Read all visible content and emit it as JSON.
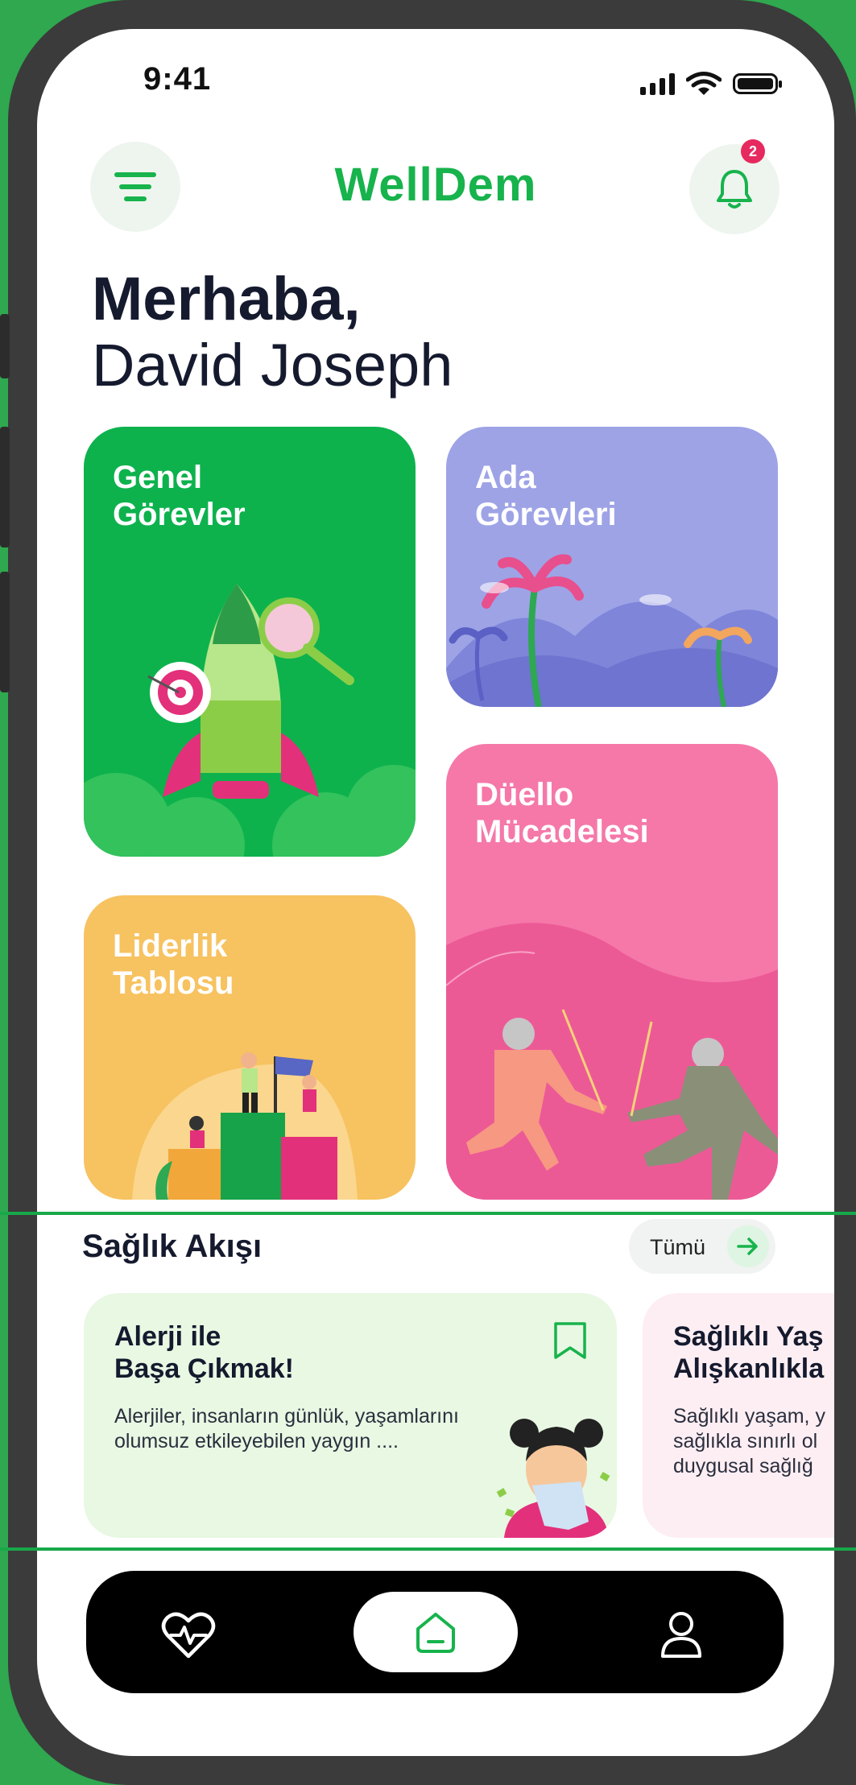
{
  "status_bar": {
    "time": "9:41"
  },
  "header": {
    "logo": "WellDem",
    "notification_count": "2"
  },
  "greeting": {
    "line1": "Merhaba,",
    "line2": "David Joseph"
  },
  "cards": {
    "general_tasks": "Genel\nGörevler",
    "island_tasks": "Ada\nGörevleri",
    "leaderboard": "Liderlik\nTablosu",
    "duel": "Düello\nMücadelesi"
  },
  "feed": {
    "title": "Sağlık Akışı",
    "all_label": "Tümü",
    "articles": [
      {
        "title": "Alerji ile\nBaşa Çıkmak!",
        "text": "Alerjiler, insanların günlük, yaşamlarını olumsuz etkileyebilen yaygın ...."
      },
      {
        "title": "Sağlıklı Yaş\nAlışkanlıkla",
        "text": "Sağlıklı yaşam, y sağlıkla sınırlı ol duygusal sağlığ"
      }
    ]
  },
  "nav": {
    "items": [
      "health-icon",
      "home-icon",
      "profile-icon"
    ]
  },
  "colors": {
    "brand": "#17b34c",
    "green_card": "#0db24d",
    "purple_card": "#9ea3e6",
    "yellow_card": "#f7c260",
    "pink_card": "#f578a9"
  }
}
